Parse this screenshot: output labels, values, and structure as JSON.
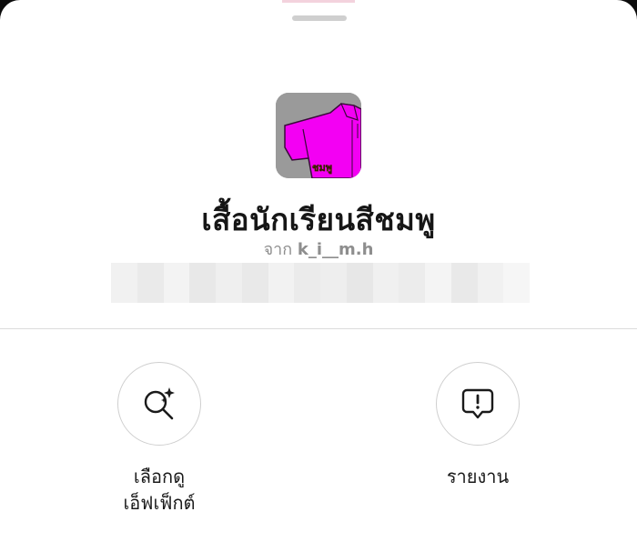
{
  "effect": {
    "title": "เสื้อนักเรียนสีชมพู",
    "creator_prefix": "จาก",
    "creator_name": "k_i__m.h",
    "thumbnail_text": "ชมพู",
    "thumbnail_icon": "pink-school-shirt-thumbnail"
  },
  "actions": [
    {
      "label": "เลือกดู\nเอ็ฟเฟ็กต์",
      "icon": "search-sparkle-icon"
    },
    {
      "label": "รายงาน",
      "icon": "report-speech-bubble-icon"
    }
  ],
  "colors": {
    "shirt": "#f300f3",
    "thumbnail_bg": "#9a9a9a",
    "secondary_text": "#8e8e8e",
    "divider": "#dbdbdb",
    "circle_border": "#cfcfcf"
  }
}
